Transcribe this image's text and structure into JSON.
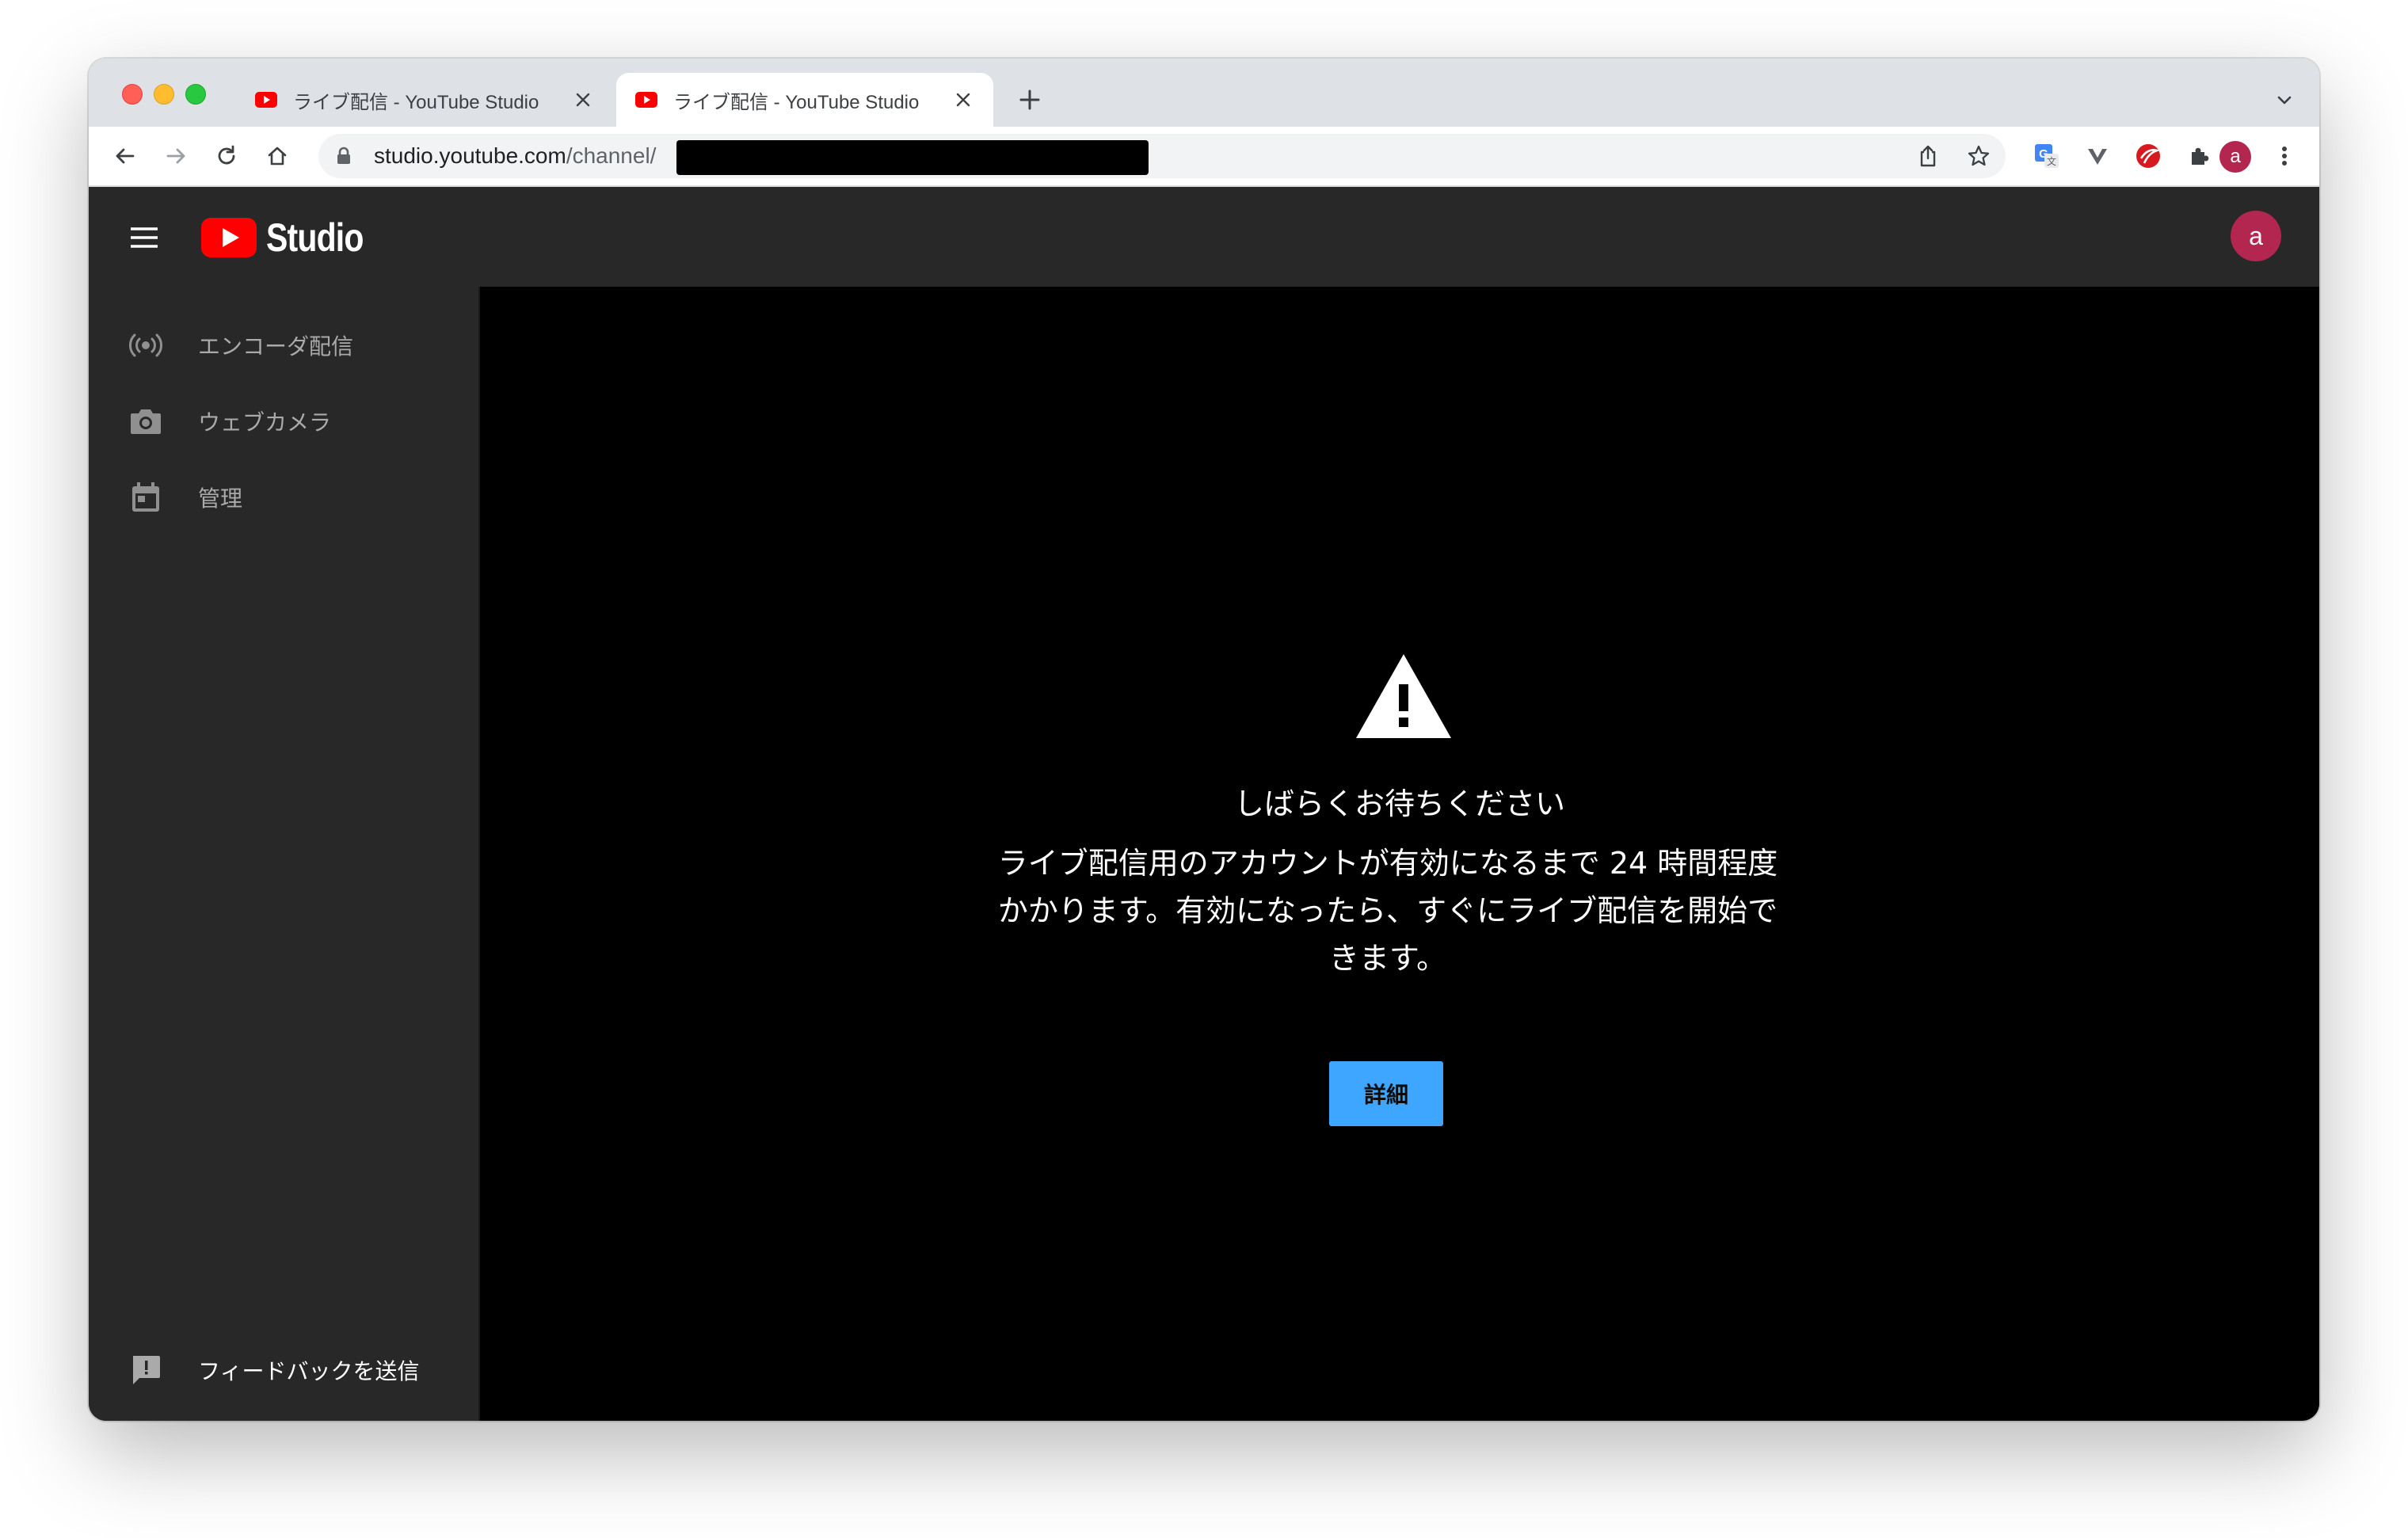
{
  "browser": {
    "tabs": [
      {
        "title": "ライブ配信 - YouTube Studio",
        "active": false
      },
      {
        "title": "ライブ配信 - YouTube Studio",
        "active": true
      }
    ],
    "new_tab_icon": "plus-icon",
    "address": {
      "host": "studio.youtube.com",
      "path": "/channel/",
      "redacted": true
    },
    "profile_initial": "a"
  },
  "studio": {
    "logo_text": "Studio",
    "account_initial": "a",
    "sidebar": {
      "items": [
        {
          "label": "エンコーダ配信",
          "icon": "broadcast-icon"
        },
        {
          "label": "ウェブカメラ",
          "icon": "camera-icon"
        },
        {
          "label": "管理",
          "icon": "calendar-icon"
        }
      ],
      "feedback": {
        "label": "フィードバックを送信",
        "icon": "feedback-icon"
      }
    },
    "notice": {
      "icon": "warning-icon",
      "title": "しばらくお待ちください",
      "body_lines": [
        "ライブ配信用のアカウントが有効になるまで 24 時間程度",
        "かかります。有効になったら、すぐにライブ配信を開始で",
        "きます。"
      ],
      "button_label": "詳細"
    }
  },
  "colors": {
    "accent_blue": "#3ea6ff",
    "youtube_red": "#ff0000",
    "avatar": "#b3264f",
    "app_bg": "#282828",
    "main_bg": "#000000"
  }
}
